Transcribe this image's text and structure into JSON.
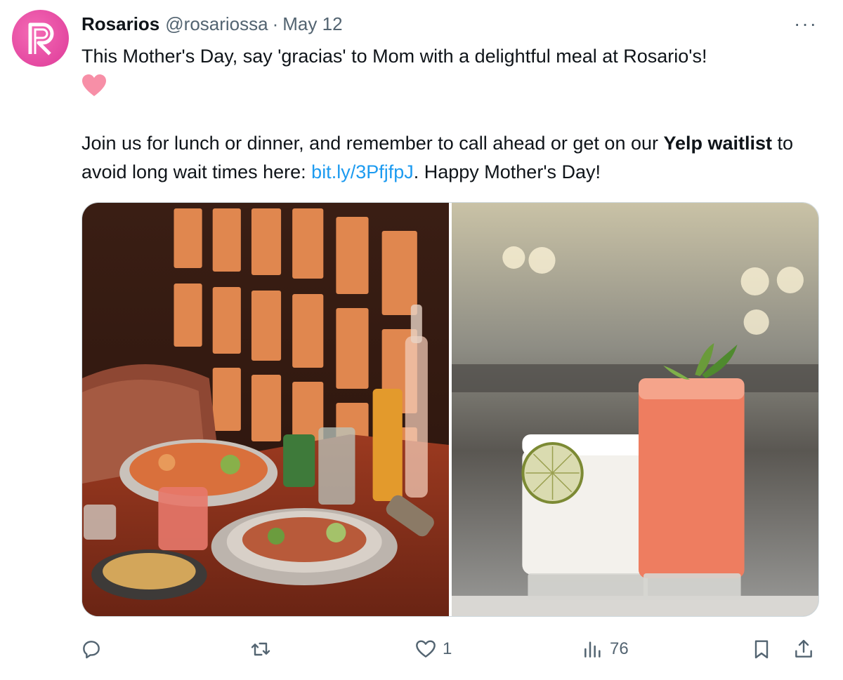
{
  "tweet": {
    "author_name": "Rosarios",
    "author_handle": "@rosariossa",
    "separator": "·",
    "date": "May 12",
    "more_label": "···",
    "line1": "This Mother's Day, say 'gracias' to Mom with a delightful meal at Rosario's!",
    "p2_a": "Join us for lunch or dinner, and remember to call ahead or get on our ",
    "p2_bold": "Yelp waitlist",
    "p2_b": " to avoid long wait times here: ",
    "p2_link": "bit.ly/3PfjfpJ",
    "p2_c": ". Happy Mother's Day!",
    "likes": "1",
    "views": "76"
  },
  "icons": {
    "avatar": "rosarios-logo-icon",
    "heart_emoji": "pink-heart-emoji",
    "reply": "reply-icon",
    "retweet": "retweet-icon",
    "like": "like-icon",
    "views": "views-icon",
    "bookmark": "bookmark-icon",
    "share": "share-icon"
  },
  "colors": {
    "brand_pink": "#dd3a98",
    "link": "#1d9bf0",
    "muted": "#536471",
    "heart": "#f78fa7"
  }
}
